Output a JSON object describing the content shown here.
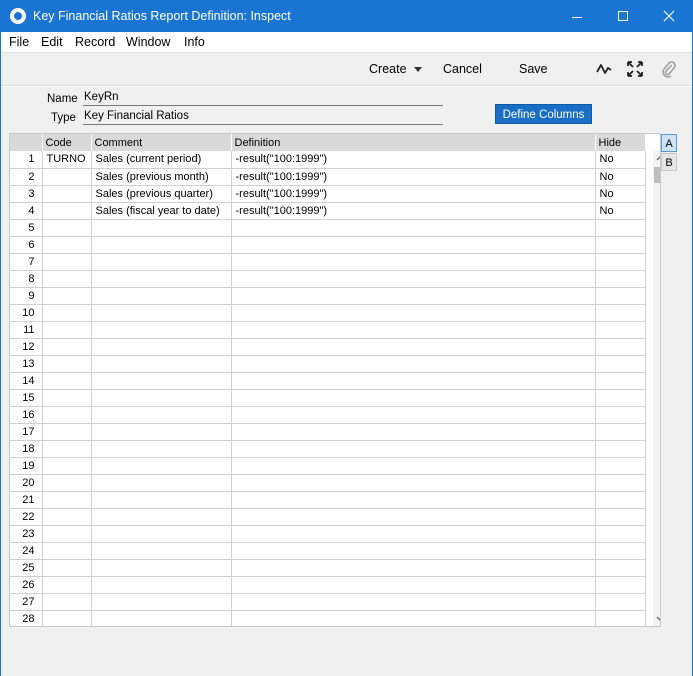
{
  "window": {
    "title": "Key Financial Ratios Report Definition: Inspect"
  },
  "menu": [
    "File",
    "Edit",
    "Record",
    "Window",
    "Info"
  ],
  "toolbar": {
    "create_label": "Create",
    "cancel_label": "Cancel",
    "save_label": "Save"
  },
  "form": {
    "name_label": "Name",
    "name_value": "KeyRn",
    "type_label": "Type",
    "type_value": "Key Financial Ratios",
    "define_columns_label": "Define Columns"
  },
  "grid": {
    "headers": [
      "",
      "Code",
      "Comment",
      "Definition",
      "Hide"
    ],
    "rows": [
      {
        "num": "1",
        "code": "TURNO",
        "comment": "Sales (current period)",
        "definition": "-result(\"100:1999\")",
        "hide": "No"
      },
      {
        "num": "2",
        "code": "",
        "comment": "Sales (previous month)",
        "definition": "-result(\"100:1999\")",
        "hide": "No"
      },
      {
        "num": "3",
        "code": "",
        "comment": "Sales (previous quarter)",
        "definition": "-result(\"100:1999\")",
        "hide": "No"
      },
      {
        "num": "4",
        "code": "",
        "comment": "Sales (fiscal year to date)",
        "definition": "-result(\"100:1999\")",
        "hide": "No"
      },
      {
        "num": "5",
        "code": "",
        "comment": "",
        "definition": "",
        "hide": ""
      },
      {
        "num": "6",
        "code": "",
        "comment": "",
        "definition": "",
        "hide": ""
      },
      {
        "num": "7",
        "code": "",
        "comment": "",
        "definition": "",
        "hide": ""
      },
      {
        "num": "8",
        "code": "",
        "comment": "",
        "definition": "",
        "hide": ""
      },
      {
        "num": "9",
        "code": "",
        "comment": "",
        "definition": "",
        "hide": ""
      },
      {
        "num": "10",
        "code": "",
        "comment": "",
        "definition": "",
        "hide": ""
      },
      {
        "num": "11",
        "code": "",
        "comment": "",
        "definition": "",
        "hide": ""
      },
      {
        "num": "12",
        "code": "",
        "comment": "",
        "definition": "",
        "hide": ""
      },
      {
        "num": "13",
        "code": "",
        "comment": "",
        "definition": "",
        "hide": ""
      },
      {
        "num": "14",
        "code": "",
        "comment": "",
        "definition": "",
        "hide": ""
      },
      {
        "num": "15",
        "code": "",
        "comment": "",
        "definition": "",
        "hide": ""
      },
      {
        "num": "16",
        "code": "",
        "comment": "",
        "definition": "",
        "hide": ""
      },
      {
        "num": "17",
        "code": "",
        "comment": "",
        "definition": "",
        "hide": ""
      },
      {
        "num": "18",
        "code": "",
        "comment": "",
        "definition": "",
        "hide": ""
      },
      {
        "num": "19",
        "code": "",
        "comment": "",
        "definition": "",
        "hide": ""
      },
      {
        "num": "20",
        "code": "",
        "comment": "",
        "definition": "",
        "hide": ""
      },
      {
        "num": "21",
        "code": "",
        "comment": "",
        "definition": "",
        "hide": ""
      },
      {
        "num": "22",
        "code": "",
        "comment": "",
        "definition": "",
        "hide": ""
      },
      {
        "num": "23",
        "code": "",
        "comment": "",
        "definition": "",
        "hide": ""
      },
      {
        "num": "24",
        "code": "",
        "comment": "",
        "definition": "",
        "hide": ""
      },
      {
        "num": "25",
        "code": "",
        "comment": "",
        "definition": "",
        "hide": ""
      },
      {
        "num": "26",
        "code": "",
        "comment": "",
        "definition": "",
        "hide": ""
      },
      {
        "num": "27",
        "code": "",
        "comment": "",
        "definition": "",
        "hide": ""
      },
      {
        "num": "28",
        "code": "",
        "comment": "",
        "definition": "",
        "hide": ""
      }
    ]
  },
  "side_tabs": [
    "A",
    "B"
  ],
  "colors": {
    "titlebar": "#1a75d2",
    "accent_button": "#1a6fc4",
    "active_tab": "#cfe3f7"
  }
}
